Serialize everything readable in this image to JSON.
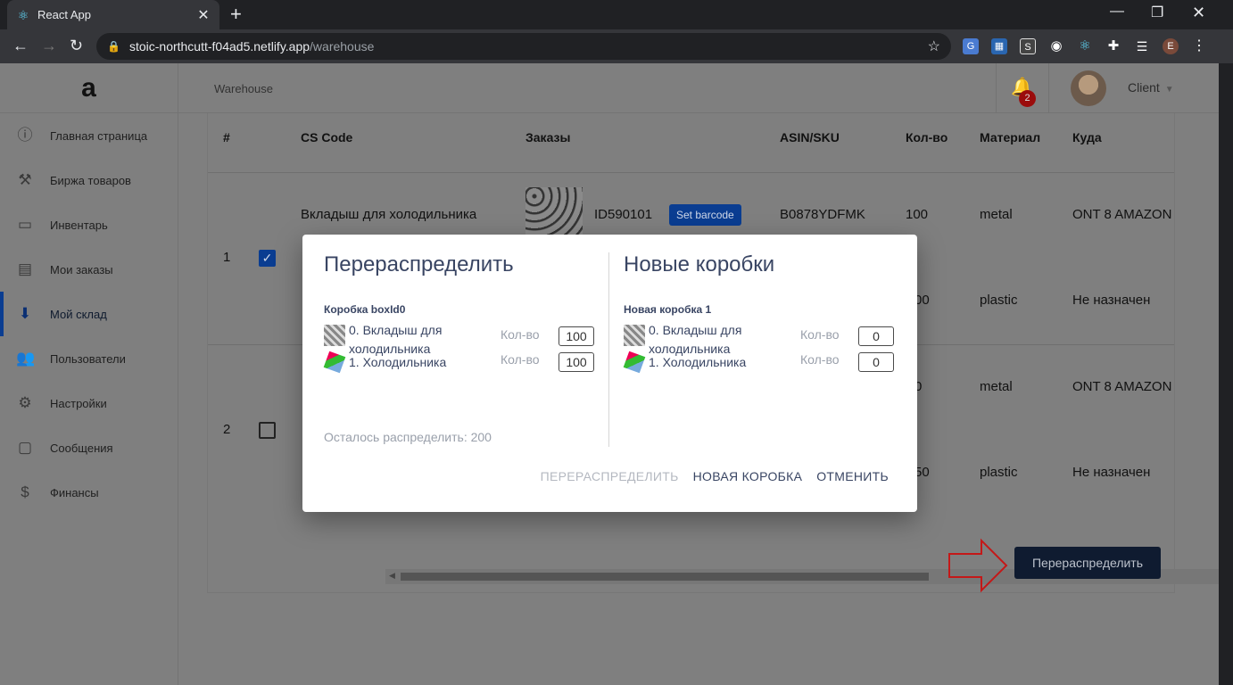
{
  "browser": {
    "tab_title": "React App",
    "url_host": "stoic-northcutt-f04ad5.netlify.app",
    "url_path": "/warehouse",
    "profile_initial": "E"
  },
  "app": {
    "breadcrumb": "Warehouse",
    "notification_count": "2",
    "user_name": "Client",
    "sidebar": [
      {
        "label": "Главная страница",
        "icon": "info-icon"
      },
      {
        "label": "Биржа товаров",
        "icon": "gavel-icon"
      },
      {
        "label": "Инвентарь",
        "icon": "inbox-icon"
      },
      {
        "label": "Мои заказы",
        "icon": "clipboard-icon"
      },
      {
        "label": "Мой склад",
        "icon": "warehouse-icon"
      },
      {
        "label": "Пользователи",
        "icon": "people-icon"
      },
      {
        "label": "Настройки",
        "icon": "gear-icon"
      },
      {
        "label": "Сообщения",
        "icon": "message-icon"
      },
      {
        "label": "Финансы",
        "icon": "dollar-icon"
      }
    ],
    "table": {
      "headers": [
        "#",
        "CS Code",
        "Заказы",
        "ASIN/SKU",
        "Кол-во",
        "Материал",
        "Куда"
      ],
      "rows": [
        {
          "num": "1",
          "cs": "Вкладыш для холодильника",
          "order": "ID590101",
          "barcode_btn": "Set barcode",
          "asin": "B0878YDFMK",
          "qty_a": "100",
          "qty_b": "00",
          "mat_a": "metal",
          "mat_b": "plastic",
          "dest_a": "ONT 8 AMAZON",
          "dest_b": "Не назначен"
        },
        {
          "num": "2",
          "qty_a": "0",
          "qty_b": "50",
          "mat_a": "metal",
          "mat_b": "plastic",
          "dest_a": "ONT 8 AMAZON",
          "dest_b": "Не назначен"
        }
      ]
    },
    "redistribute_button": "Перераспределить"
  },
  "modal": {
    "left_title": "Перераспределить",
    "left_box": "Коробка boxId0",
    "left_items": [
      {
        "name": "0. Вкладыш для холодильника",
        "qty_label": "Кол-во",
        "qty": "100"
      },
      {
        "name": "1. Холодильника",
        "qty_label": "Кол-во",
        "qty": "100"
      }
    ],
    "remaining": "Осталось распределить: 200",
    "right_title": "Новые коробки",
    "right_box": "Новая коробка 1",
    "right_items": [
      {
        "name": "0. Вкладыш для холодильника",
        "qty_label": "Кол-во",
        "qty": "0"
      },
      {
        "name": "1. Холодильника",
        "qty_label": "Кол-во",
        "qty": "0"
      }
    ],
    "btn_redistribute": "ПЕРЕРАСПРЕДЕЛИТЬ",
    "btn_new_box": "НОВАЯ КОРОБКА",
    "btn_cancel": "ОТМЕНИТЬ"
  }
}
